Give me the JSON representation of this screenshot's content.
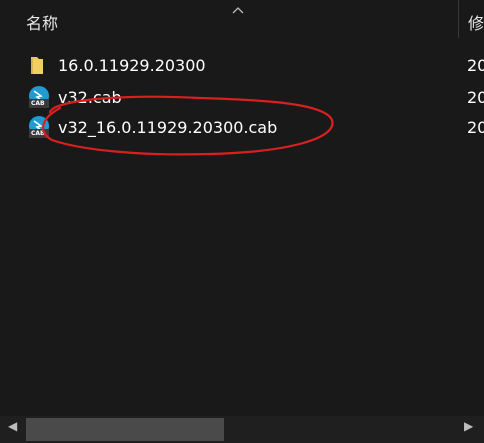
{
  "header": {
    "name_column": "名称",
    "date_column": "修",
    "sort_indicator": "caret-up-icon"
  },
  "files": [
    {
      "name": "16.0.11929.20300",
      "date": "20",
      "icon": "folder-icon"
    },
    {
      "name": "v32.cab",
      "date": "20",
      "icon": "cab-file-icon",
      "icon_label": "CAB"
    },
    {
      "name": "v32_16.0.11929.20300.cab",
      "date": "20",
      "icon": "cab-file-icon",
      "icon_label": "CAB"
    }
  ],
  "annotation": {
    "color": "#d92020",
    "shape": "freehand-ellipse"
  },
  "colors": {
    "background": "#191919",
    "folder": "#e8c45a",
    "cab_icon": "#1f9bd1"
  }
}
